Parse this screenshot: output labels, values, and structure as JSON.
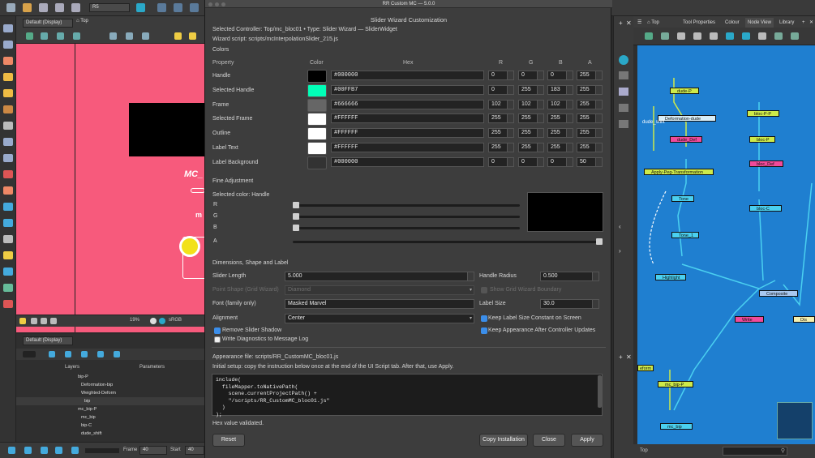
{
  "host": {
    "toolbar_combo": "R5",
    "view_preset": "Default (Display)",
    "view_breadcrumb": "Top",
    "canvas_text": "MC_",
    "canvas_text2": "m",
    "zoom": "19%",
    "colorspace": "sRGB",
    "timeline_preset": "Default (Display)",
    "layers_header": "Layers",
    "params_header": "Parameters",
    "layers": [
      "bip-P",
      "Deformation-bip",
      "Weighted-Deform",
      "bip",
      "mc_bip-P",
      "mc_bip",
      "bip-C",
      "dude_shift"
    ],
    "transport": {
      "frame_label": "Frame",
      "frame_value": "40",
      "start_label": "Start",
      "start_value": "40"
    },
    "node_breadcrumb": "Top",
    "node_tabs": [
      "Tool Properties",
      "Colour",
      "Node View",
      "Library"
    ],
    "node_active_tab": "Node View",
    "nodes": [
      "dude-P",
      "Deformation-dude",
      "dude_shift",
      "dude_Def",
      "bloc-P-P",
      "bloc-P",
      "Apply-Peg-Transformation",
      "bloc_Def",
      "Tone",
      "bloc-C",
      "Tone_1",
      "Highlight",
      "Composite",
      "Write",
      "Dis",
      "mc_bip-P",
      "mc_bip",
      "eform"
    ],
    "node_bottom_breadcrumb": "Top"
  },
  "dialog": {
    "window_title": "RR Custom MC — 5.0.0",
    "heading": "Slider Wizard Customization",
    "selected_controller": "Selected Controller: Top/mc_bloc01 • Type: Slider Wizard — SliderWidget",
    "wizard_script": "Wizard script: scripts/mcInterpolationSlider_215.js",
    "colors_section": "Colors",
    "col_headers": {
      "property": "Property",
      "color": "Color",
      "hex": "Hex",
      "r": "R",
      "g": "G",
      "b": "B",
      "a": "A"
    },
    "color_rows": [
      {
        "label": "Handle",
        "swatch": "#000000",
        "hex": "#000000",
        "r": "0",
        "g": "0",
        "b": "0",
        "a": "255"
      },
      {
        "label": "Selected Handle",
        "swatch": "#00FFB7",
        "hex": "#00FFB7",
        "r": "0",
        "g": "255",
        "b": "183",
        "a": "255"
      },
      {
        "label": "Frame",
        "swatch": "#666666",
        "hex": "#666666",
        "r": "102",
        "g": "102",
        "b": "102",
        "a": "255"
      },
      {
        "label": "Selected Frame",
        "swatch": "#FFFFFF",
        "hex": "#FFFFFF",
        "r": "255",
        "g": "255",
        "b": "255",
        "a": "255"
      },
      {
        "label": "Outline",
        "swatch": "#FFFFFF",
        "hex": "#FFFFFF",
        "r": "255",
        "g": "255",
        "b": "255",
        "a": "255"
      },
      {
        "label": "Label Text",
        "swatch": "#FFFFFF",
        "hex": "#FFFFFF",
        "r": "255",
        "g": "255",
        "b": "255",
        "a": "255"
      },
      {
        "label": "Label Background",
        "swatch": "#333333",
        "hex": "#000000",
        "r": "0",
        "g": "0",
        "b": "0",
        "a": "50"
      }
    ],
    "fine_adjustment": "Fine Adjustment",
    "selected_color": "Selected color: Handle",
    "channels": [
      {
        "label": "R",
        "level": 0.0
      },
      {
        "label": "G",
        "level": 0.0
      },
      {
        "label": "B",
        "level": 0.0
      },
      {
        "label": "A",
        "level": 1.0
      }
    ],
    "preview_color": "#000000",
    "dims_section": "Dimensions, Shape and Label",
    "slider_length_label": "Slider Length",
    "slider_length": "5.000",
    "handle_radius_label": "Handle Radius",
    "handle_radius": "0.500",
    "handle_shape_label": "Point Shape (Grid Wizard)",
    "handle_shape": "Diamond",
    "snap_label": "Show Grid Wizard Boundary",
    "font_label": "Font (family only)",
    "font_value": "Masked Marvel",
    "label_size_label": "Label Size",
    "label_size": "30.0",
    "alignment_label": "Alignment",
    "alignment_value": "Center",
    "keep_label_size": "Keep Label Size Constant on Screen",
    "remove_shadow": "Remove Slider Shadow",
    "keep_appearance": "Keep Appearance After Controller Updates",
    "write_diag": "Write Diagnostics to Message Log",
    "appearance_file": "Appearance file: scripts/RR_CustomMC_bloc01.js",
    "initial_setup": "Initial setup: copy the instruction below once at the end of the UI Script tab. After that, use Apply.",
    "code": "include(\n  fileMapper.toNativePath(\n    scene.currentProjectPath() +\n    \"/scripts/RR_CustomMC_bloc01.js\"\n  )\n);",
    "status": "Hex value validated.",
    "buttons": {
      "reset": "Reset",
      "copy": "Copy Installation",
      "close": "Close",
      "apply": "Apply"
    }
  }
}
